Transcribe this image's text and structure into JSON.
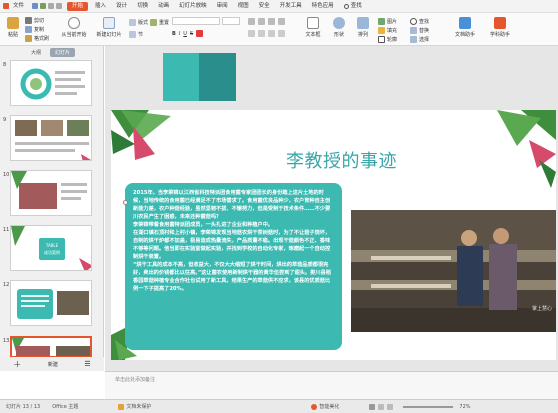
{
  "menubar": {
    "file": "文件",
    "tabs": [
      "开始",
      "插入",
      "设计",
      "切换",
      "动画",
      "幻灯片放映",
      "审阅",
      "视图",
      "安全",
      "开发工具",
      "特色应用"
    ],
    "active_tab": "开始",
    "search": "查找"
  },
  "ribbon": {
    "paste": "粘贴",
    "cut": "剪切",
    "copy": "复制",
    "format_painter": "格式刷",
    "from_current": "从当前开始",
    "new_slide": "新建幻灯片",
    "layout": "版式",
    "section": "节",
    "reset": "重置",
    "text_box": "文本框",
    "shapes": "形状",
    "arrange": "排列",
    "picture": "图片",
    "fill": "填充",
    "outline": "轮廓",
    "find": "查找",
    "replace": "替换",
    "select": "选择",
    "doc_helper": "文档助手",
    "scholar_tools": "学科助手"
  },
  "left_pane": {
    "tabs": [
      "大纲",
      "幻灯片"
    ],
    "active_tab": "幻灯片",
    "slide_numbers": [
      "8",
      "9",
      "10",
      "11",
      "12",
      "13"
    ],
    "selected_slide": "13",
    "thumb_labels": [
      "TABLE",
      "成功案例"
    ],
    "new_label": "新建"
  },
  "slide": {
    "title": "李教授的事迹",
    "body": [
      "2015年，当李荣锦以江西省科技特派团食用菌专家团团长的身份踏上这片土地的时候，当地传统的食用菌已经满足不了市场需求了。食用菌优良品种少，农户育种自主创新能力差，农户种菇经验，虽然坚韧不拔、不懈努力，但是受制于技术条件……不少要川农民产生了困惑，未来还种菌菇吗？",
      "李荣锦带着食用菌特派团成员，一头扎进了企业和种植户中。",
      "在湖口镇石顶村和上村小镇，李荣锦发现当地菇农烘干茶树菇时，为了不让菇子烧坏，自制的烘干炉都不加盖，极易造成热量流失，产品质量不稳。出现干菇颜色不正、香味不够等问题。他当即在实验室做起实验，并找到学校的自动化专家，琢磨起一个自动控制烘干装置。",
      "“烘干工具的成本不高，但收益大，不仅大大缩短了烘干时间，烘出的草菇品质都很完好，卖出的价钱都比以往高。”这让菌农使用新制烘干器的黄华伍尝到了甜头。娄川县稻香园草菇种植专业合作社也试用了新工具，结果生产的草菇供不应求，该县的优质菇比例一下子提高了20%。"
    ],
    "watermark": "掌上慧心"
  },
  "notes": {
    "placeholder": "单击此处添加备注"
  },
  "statusbar": {
    "page": "幻灯片 13 / 13",
    "theme": "Office 主题",
    "doc_status": "文档未保护",
    "smart_beautify": "智能美化",
    "zoom": "72%"
  },
  "colors": {
    "accent": "#e4572e",
    "teal": "#3cbab2",
    "title_teal": "#3aa6a8",
    "block_teal_dark": "#2a8f8c"
  }
}
